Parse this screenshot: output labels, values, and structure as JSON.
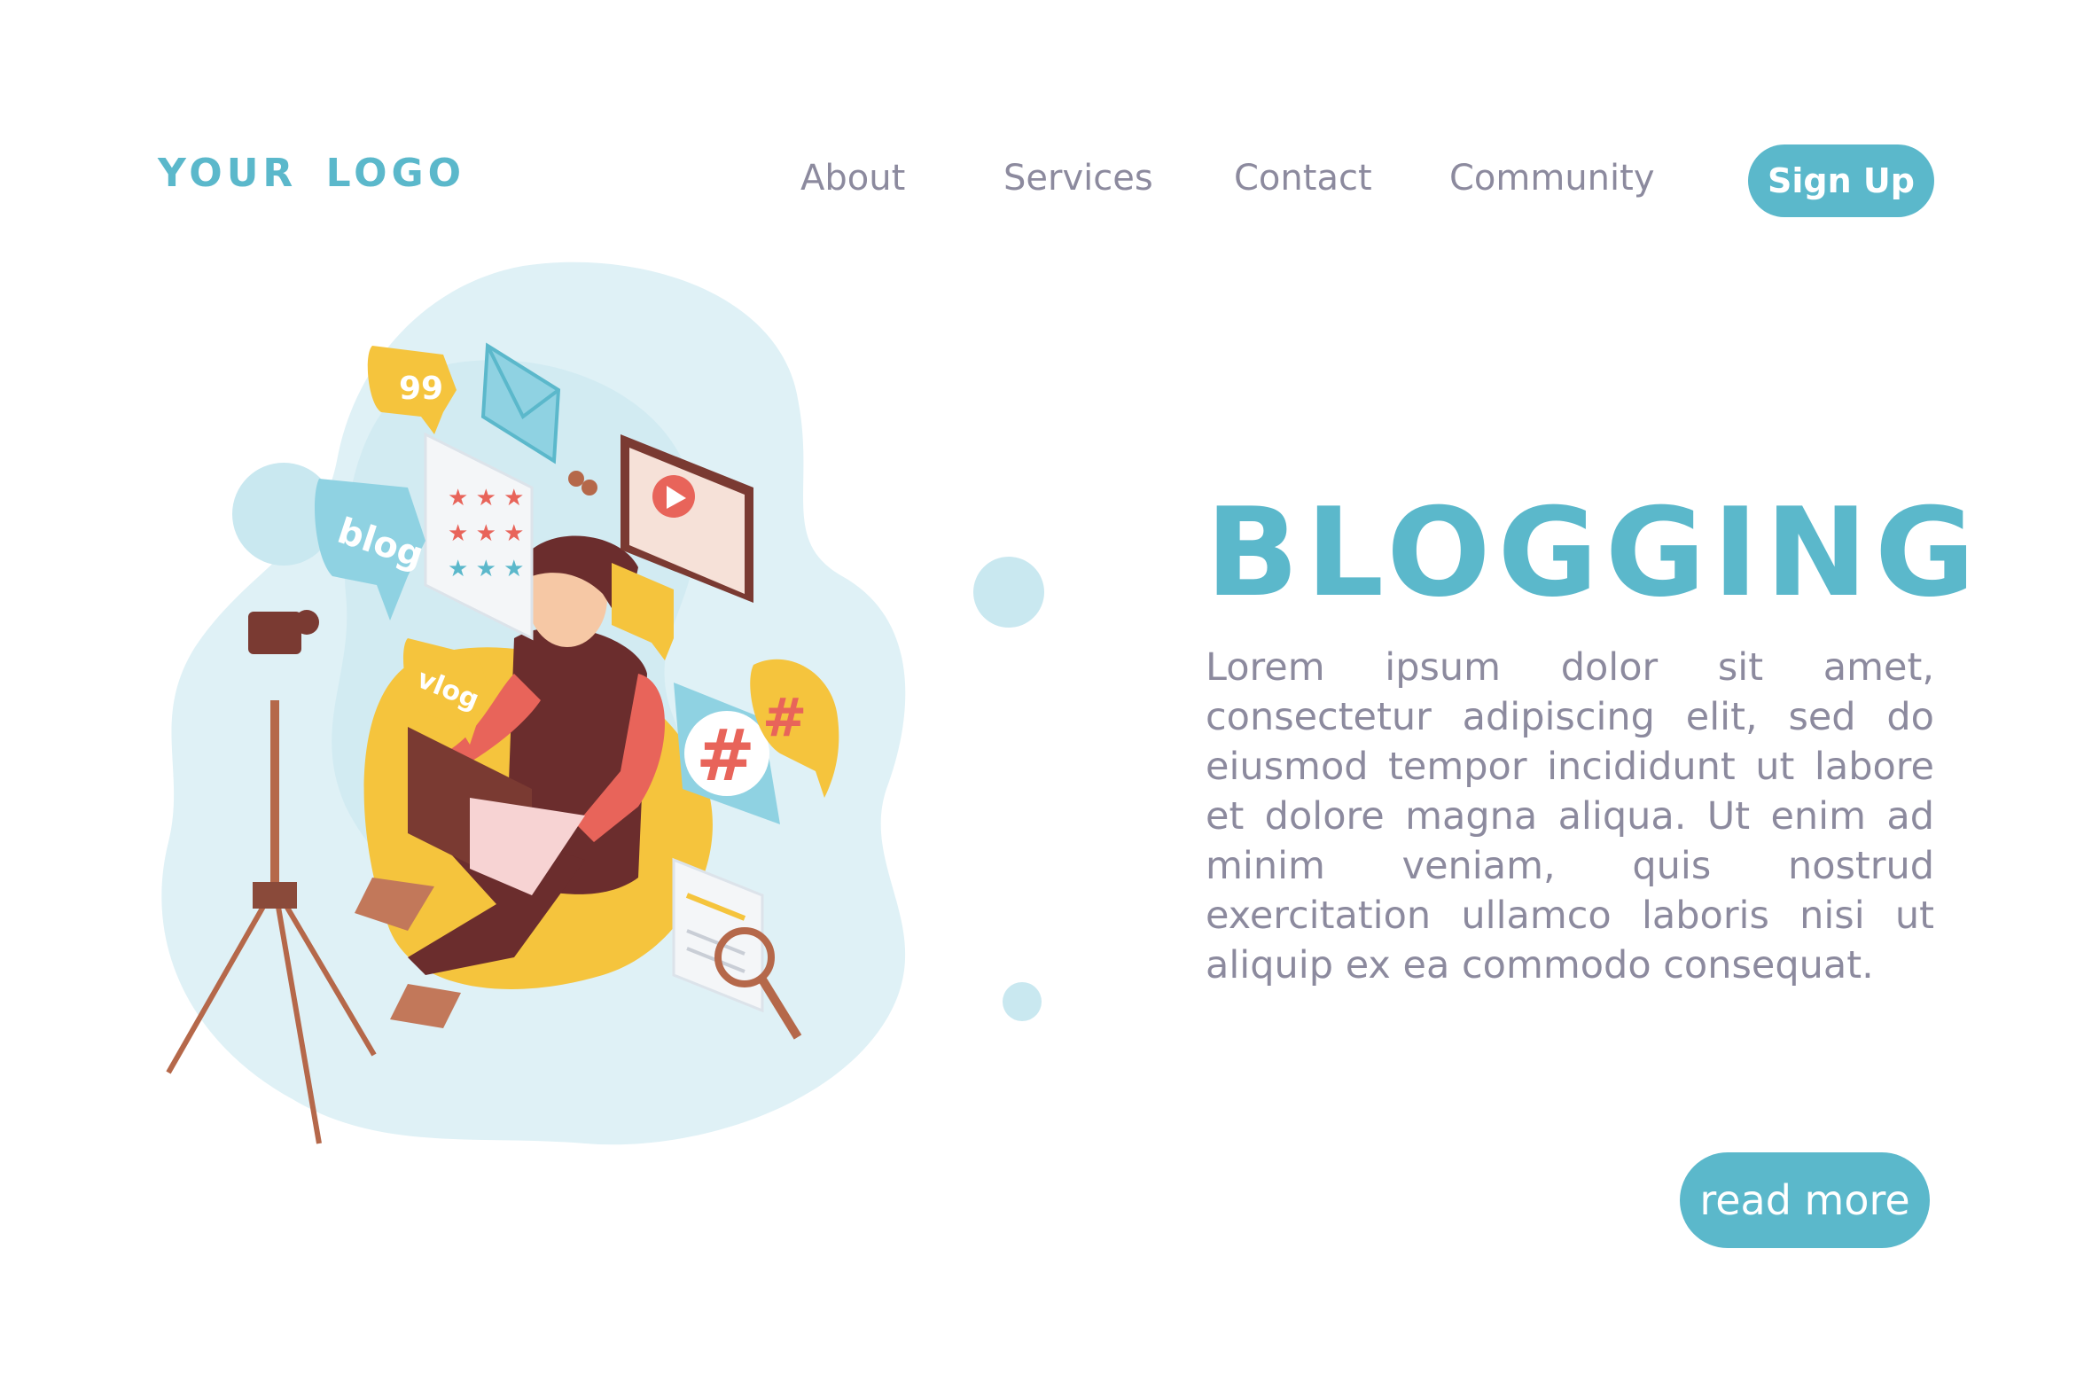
{
  "header": {
    "logo": "YOUR LOGO",
    "nav": [
      "About",
      "Services",
      "Contact",
      "Community"
    ],
    "signup_label": "Sign Up"
  },
  "hero": {
    "title": "BLOGGING",
    "body": "Lorem ipsum dolor sit amet, consectetur adipiscing elit, sed do eiusmod tempor incididunt ut labore et dolore magna aliqua. Ut enim ad minim veniam, quis nostrud exercitation ullamco laboris nisi ut aliquip ex ea commodo consequat.",
    "read_more_label": "read more"
  },
  "illustration": {
    "blog_bubble": "blog",
    "vlog_bubble": "vlog",
    "hashtag": "#",
    "quote": "99"
  },
  "colors": {
    "accent": "#5bb8cb",
    "text_muted": "#8c8a9e",
    "blob": "#dff1f6",
    "beanbag": "#f5c43d",
    "shirt": "#6b2d2d",
    "sleeve": "#e8645a"
  }
}
